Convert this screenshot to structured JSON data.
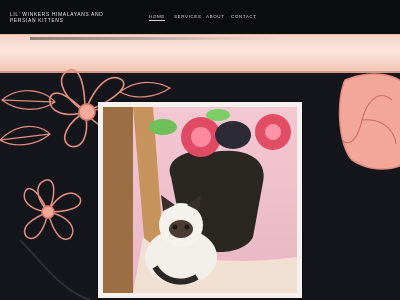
{
  "header": {
    "brand": "LIL' WINKERS HIMALAYANS AND PERSIAN KITTENS",
    "nav": [
      "HOME",
      "SERVICES",
      "ABOUT",
      "CONTACT"
    ]
  },
  "colors": {
    "background": "#14161b",
    "topbar": "#0b0c0e",
    "accent_pink": "#f2a99a",
    "flower_outline": "#e58e80"
  },
  "hero_photo": {
    "subject": "himalayan-kitten-with-flower-pot"
  }
}
